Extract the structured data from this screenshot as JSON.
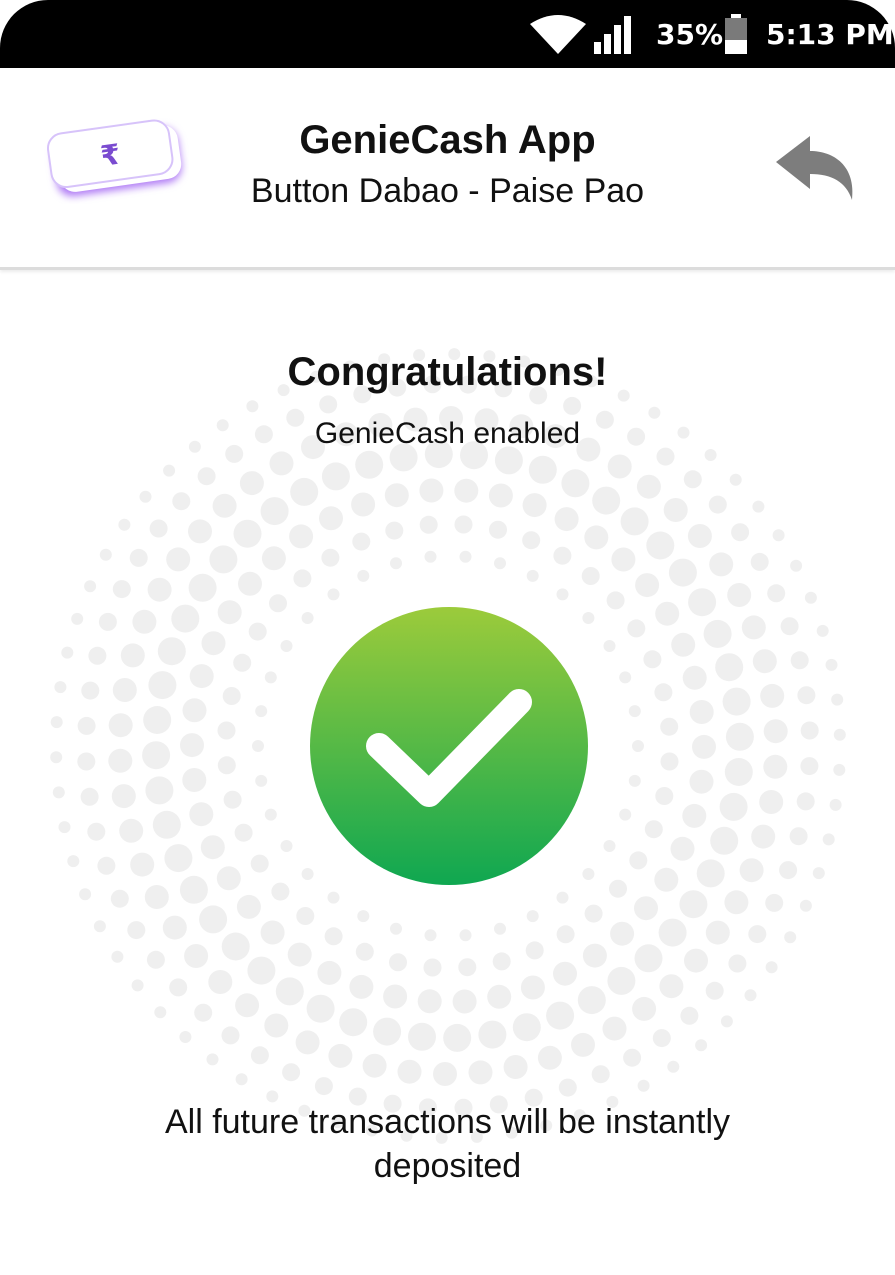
{
  "status_bar": {
    "battery_percent": "35%",
    "time": "5:13 PM",
    "icons": [
      "wifi-icon",
      "signal-icon",
      "battery-icon"
    ]
  },
  "header": {
    "title": "GenieCash App",
    "subtitle": "Button Dabao - Paise Pao",
    "logo_symbol": "₹",
    "back_icon": "reply-arrow-icon"
  },
  "content": {
    "heading": "Congratulations!",
    "status": "GenieCash enabled",
    "success_icon": "check-circle-icon",
    "message": "All future transactions will be instantly deposited"
  },
  "colors": {
    "status_bar_bg": "#000000",
    "success_gradient_top": "#9ccb3b",
    "success_gradient_bottom": "#0fa751",
    "logo_glow": "#a66bf2",
    "back_arrow": "#7d7d7d",
    "dots": "#efefef"
  }
}
